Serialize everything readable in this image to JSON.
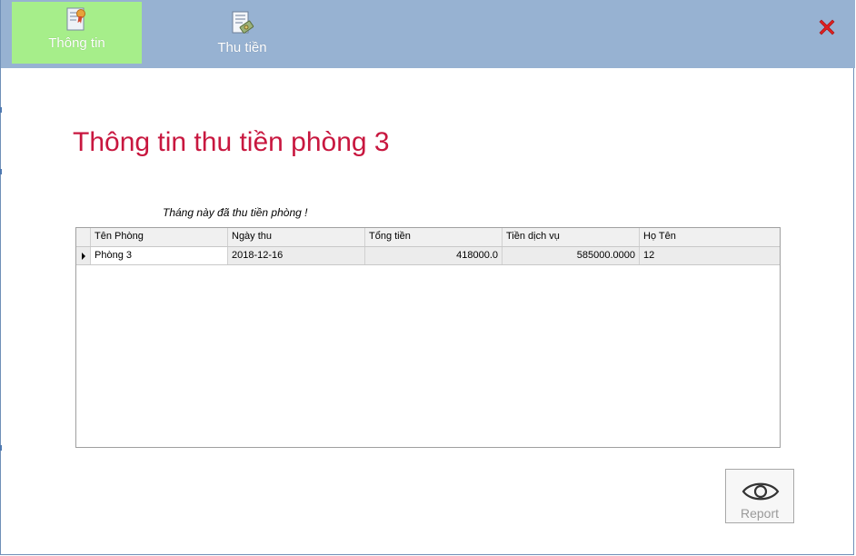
{
  "toolbar": {
    "tabs": [
      {
        "label": "Thông tin",
        "icon": "certificate-icon",
        "active": true
      },
      {
        "label": "Thu tiền",
        "icon": "invoice-money-icon",
        "active": false
      }
    ],
    "close_icon": "close-icon"
  },
  "colors": {
    "topbar": "#97b2d2",
    "active_tab": "#a6ee8a",
    "title": "#c8173f",
    "close": "#e02020"
  },
  "main": {
    "title": "Thông tin thu tiền phòng 3",
    "notice": "Tháng này đã thu tiền phòng !"
  },
  "grid": {
    "columns": [
      "Tên Phòng",
      "Ngày thu",
      "Tổng tiền",
      "Tiền dịch vụ",
      "Họ Tên"
    ],
    "rows": [
      [
        "Phòng 3",
        "2018-12-16",
        "418000.0",
        "585000.0000",
        "12"
      ]
    ]
  },
  "report": {
    "label": "Report",
    "icon": "eye-icon"
  }
}
